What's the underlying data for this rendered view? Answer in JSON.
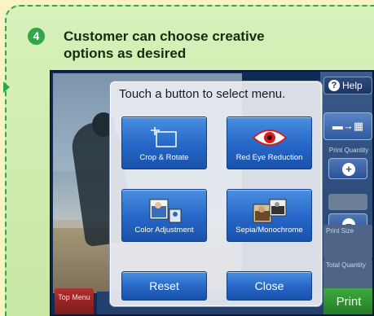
{
  "step": {
    "number": "4",
    "title": "Customer can choose creative options as desired"
  },
  "app": {
    "help_label": "Help",
    "print_quantity_label": "Print Quantity",
    "print_size_label": "Print Size",
    "total_quantity_label": "Total Quantity",
    "print_label": "Print",
    "top_menu_label": "Top Menu"
  },
  "dialog": {
    "title": "Touch a button to select menu.",
    "options": [
      {
        "label": "Crop & Rotate",
        "icon": "crop-rotate-icon"
      },
      {
        "label": "Red Eye Reduction",
        "icon": "red-eye-icon"
      },
      {
        "label": "Color Adjustment",
        "icon": "color-adjustment-icon"
      },
      {
        "label": "Sepia/Monochrome",
        "icon": "sepia-monochrome-icon"
      }
    ],
    "reset_label": "Reset",
    "close_label": "Close"
  },
  "colors": {
    "card_border": "#2ea84a",
    "button_blue": "#2566c7",
    "print_green": "#237a23",
    "top_menu_red": "#b03030"
  }
}
